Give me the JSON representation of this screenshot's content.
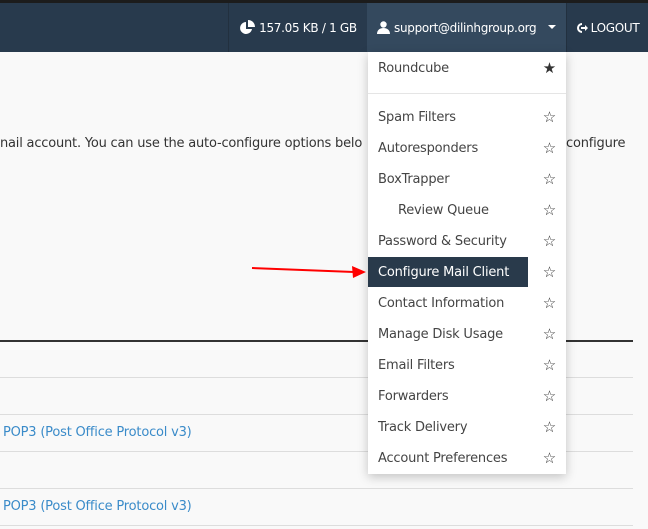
{
  "header": {
    "storage": "157.05 KB / 1 GB",
    "user": "support@dilinhgroup.org",
    "logout": "LOGOUT"
  },
  "main": {
    "intro_left": "nail account. You can use the auto-configure options belo",
    "intro_right": "configure",
    "links": [
      "POP3 (Post Office Protocol v3)",
      "POP3 (Post Office Protocol v3)"
    ]
  },
  "menu": {
    "items": [
      {
        "label": "Roundcube",
        "favorite": true
      },
      {
        "label": "Spam Filters",
        "favorite": false
      },
      {
        "label": "Autoresponders",
        "favorite": false
      },
      {
        "label": "BoxTrapper",
        "favorite": false
      },
      {
        "label": "Review Queue",
        "favorite": false
      },
      {
        "label": "Password & Security",
        "favorite": false
      },
      {
        "label": "Configure Mail Client",
        "favorite": false,
        "active": true
      },
      {
        "label": "Contact Information",
        "favorite": false
      },
      {
        "label": "Manage Disk Usage",
        "favorite": false
      },
      {
        "label": "Email Filters",
        "favorite": false
      },
      {
        "label": "Forwarders",
        "favorite": false
      },
      {
        "label": "Track Delivery",
        "favorite": false
      },
      {
        "label": "Account Preferences",
        "favorite": false
      }
    ]
  },
  "colors": {
    "topbar": "#283a4d",
    "active": "#293a4b",
    "link": "#3a8bc9",
    "arrow": "#ff0000"
  }
}
